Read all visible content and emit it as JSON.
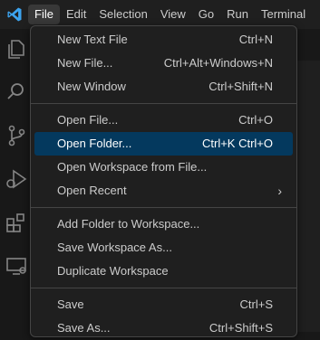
{
  "menubar": {
    "items": [
      {
        "label": "File"
      },
      {
        "label": "Edit"
      },
      {
        "label": "Selection"
      },
      {
        "label": "View"
      },
      {
        "label": "Go"
      },
      {
        "label": "Run"
      },
      {
        "label": "Terminal"
      }
    ]
  },
  "activity_icons": [
    "explorer-icon",
    "search-icon",
    "source-control-icon",
    "run-debug-icon",
    "extensions-icon",
    "remote-explorer-icon"
  ],
  "file_menu": {
    "items": [
      {
        "label": "New Text File",
        "shortcut": "Ctrl+N"
      },
      {
        "label": "New File...",
        "shortcut": "Ctrl+Alt+Windows+N"
      },
      {
        "label": "New Window",
        "shortcut": "Ctrl+Shift+N"
      },
      {
        "label": "Open File...",
        "shortcut": "Ctrl+O"
      },
      {
        "label": "Open Folder...",
        "shortcut": "Ctrl+K Ctrl+O",
        "highlighted": true
      },
      {
        "label": "Open Workspace from File...",
        "shortcut": ""
      },
      {
        "label": "Open Recent",
        "shortcut": "",
        "submenu": true
      },
      {
        "label": "Add Folder to Workspace...",
        "shortcut": ""
      },
      {
        "label": "Save Workspace As...",
        "shortcut": ""
      },
      {
        "label": "Duplicate Workspace",
        "shortcut": ""
      },
      {
        "label": "Save",
        "shortcut": "Ctrl+S"
      },
      {
        "label": "Save As...",
        "shortcut": "Ctrl+Shift+S"
      }
    ]
  },
  "colors": {
    "accent_logo": "#3ca4f0",
    "highlight_row": "#04395e",
    "menu_bg": "#1f1f1f"
  }
}
